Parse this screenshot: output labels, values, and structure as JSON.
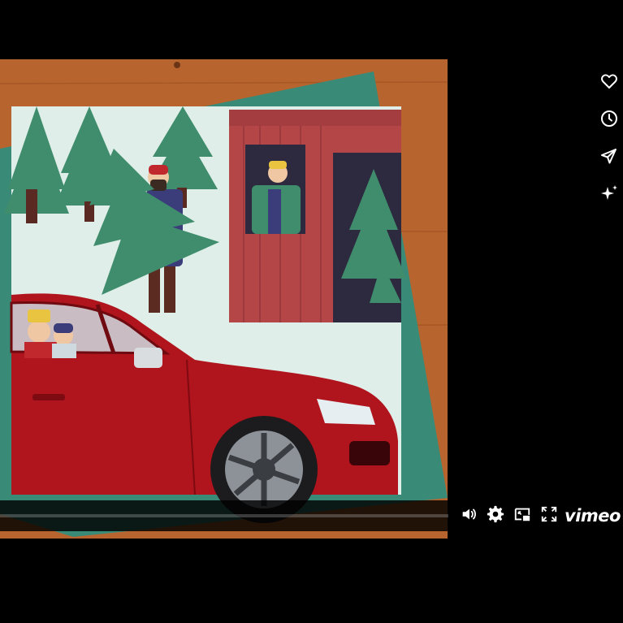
{
  "player": {
    "logo_text": "vimeo",
    "progress": 0.0,
    "side_actions": [
      {
        "name": "like",
        "icon": "heart-icon"
      },
      {
        "name": "watch-later",
        "icon": "clock-icon"
      },
      {
        "name": "share",
        "icon": "paper-plane-icon"
      },
      {
        "name": "ai",
        "icon": "sparkle-icon"
      }
    ],
    "controls": [
      {
        "name": "volume",
        "icon": "volume-icon"
      },
      {
        "name": "settings",
        "icon": "gear-icon"
      },
      {
        "name": "picture-in-picture",
        "icon": "pip-icon"
      },
      {
        "name": "fullscreen",
        "icon": "fullscreen-icon"
      }
    ]
  },
  "colors": {
    "background": "#000000",
    "wood": "#b8642e",
    "card_red": "#b54648",
    "tree_green": "#3d8f6e",
    "car_red": "#b0141c",
    "accent_white": "#ffffff"
  }
}
